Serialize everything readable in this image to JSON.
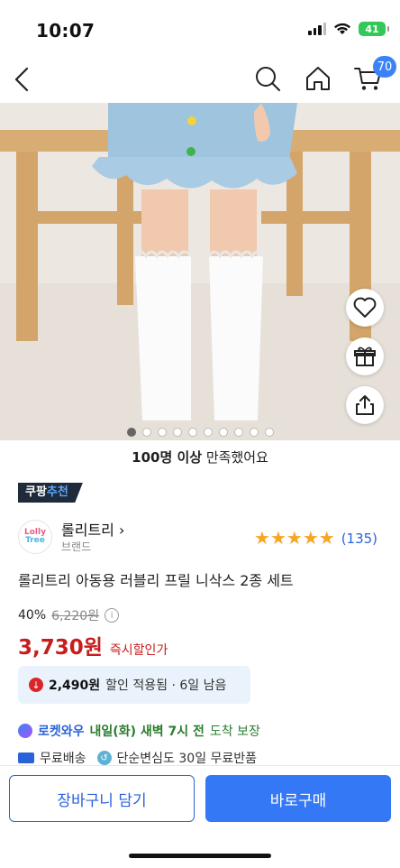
{
  "status": {
    "time": "10:07",
    "battery": "41"
  },
  "nav": {
    "cart_count": "70"
  },
  "image": {
    "page_count": 10,
    "active_index": 0
  },
  "satisfaction": {
    "bold": "100명 이상",
    "rest": " 만족했어요"
  },
  "badge": {
    "part1": "쿠팡",
    "part2": "추천"
  },
  "brand": {
    "logo_text1": "Lolly",
    "logo_text2": "Tree",
    "name": "롤리트리 ›",
    "sub": "브랜드"
  },
  "rating": {
    "stars": 5,
    "count": "(135)"
  },
  "product": {
    "title": "롤리트리 아동용 러블리 프릴 니삭스 2종 세트"
  },
  "pricing": {
    "discount": "40%",
    "original": "6,220원",
    "price": "3,730원",
    "price_tag": "즉시할인가"
  },
  "coupon": {
    "amount": "2,490원",
    "text": " 할인 적용됨 · 6일 남음"
  },
  "delivery": {
    "brand": "로켓와우",
    "day": "내일(화) 새벽 7시 전",
    "suffix": "도착 보장"
  },
  "shipping": {
    "free": "무료배송",
    "returns": "단순변심도 30일 무료반품"
  },
  "actions": {
    "cart": "장바구니 담기",
    "buy": "바로구매"
  },
  "colors": {
    "accent": "#3478f6",
    "price_red": "#c81d1d",
    "star": "#f5a623"
  }
}
